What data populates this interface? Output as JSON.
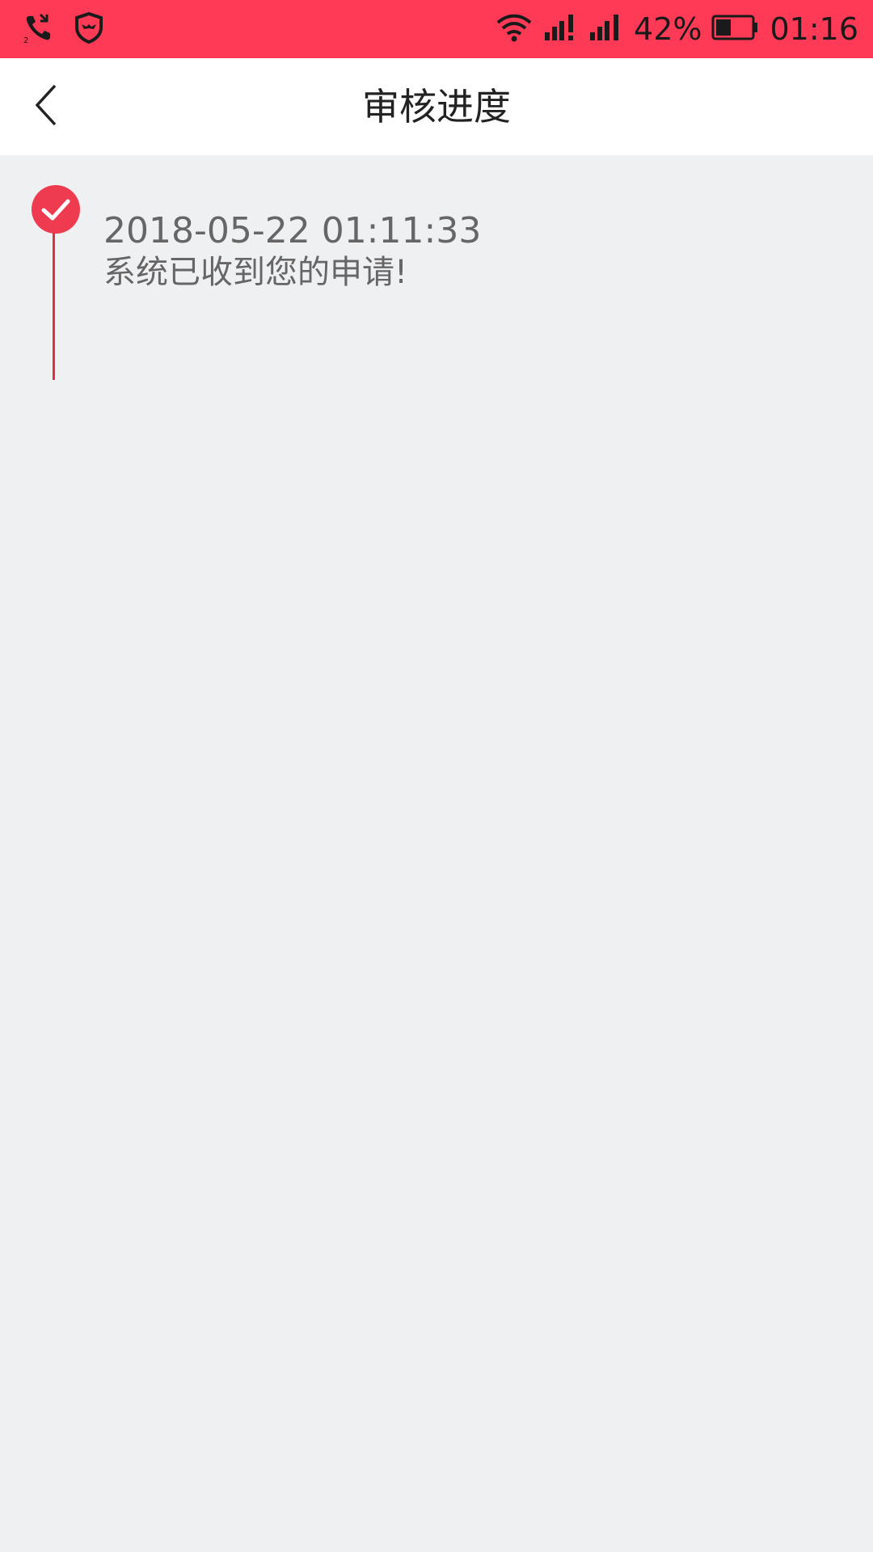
{
  "status_bar": {
    "battery_percent": "42%",
    "time": "01:16",
    "battery_level": 0.42,
    "icons": [
      "missed-call-icon",
      "shield-icon",
      "wifi-icon",
      "signal-sim1-icon",
      "signal-sim2-icon",
      "battery-icon"
    ],
    "background_color": "#ff3a57"
  },
  "nav": {
    "title": "审核进度",
    "back_icon": "chevron-left-icon"
  },
  "timeline": {
    "accent_color": "#e0303f",
    "items": [
      {
        "time": "2018-05-22 01:11:33",
        "description": "系统已收到您的申请!",
        "icon": "check-circle-icon"
      }
    ]
  }
}
